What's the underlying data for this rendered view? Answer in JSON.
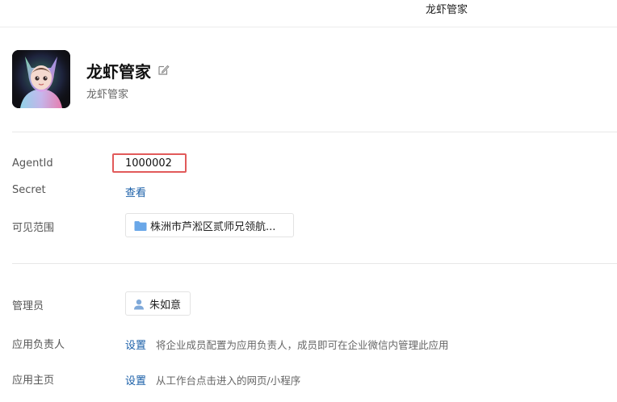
{
  "topbar": {
    "title": "龙虾管家"
  },
  "app": {
    "name": "龙虾管家",
    "subtitle": "龙虾管家"
  },
  "fields": {
    "agentid": {
      "label": "AgentId",
      "value": "1000002"
    },
    "secret": {
      "label": "Secret",
      "action": "查看"
    },
    "visibility": {
      "label": "可见范围",
      "value": "株洲市芦淞区贰师兄领航..."
    },
    "admin": {
      "label": "管理员",
      "value": "朱如意"
    },
    "owner": {
      "label": "应用负责人",
      "action": "设置",
      "description": "将企业成员配置为应用负责人，成员即可在企业微信内管理此应用"
    },
    "homepage": {
      "label": "应用主页",
      "action": "设置",
      "description": "从工作台点击进入的网页/小程序"
    }
  },
  "colors": {
    "link": "#1a5fa8",
    "highlight": "#e15a5a",
    "folder": "#6aa7e8",
    "person": "#7fa9d9"
  }
}
